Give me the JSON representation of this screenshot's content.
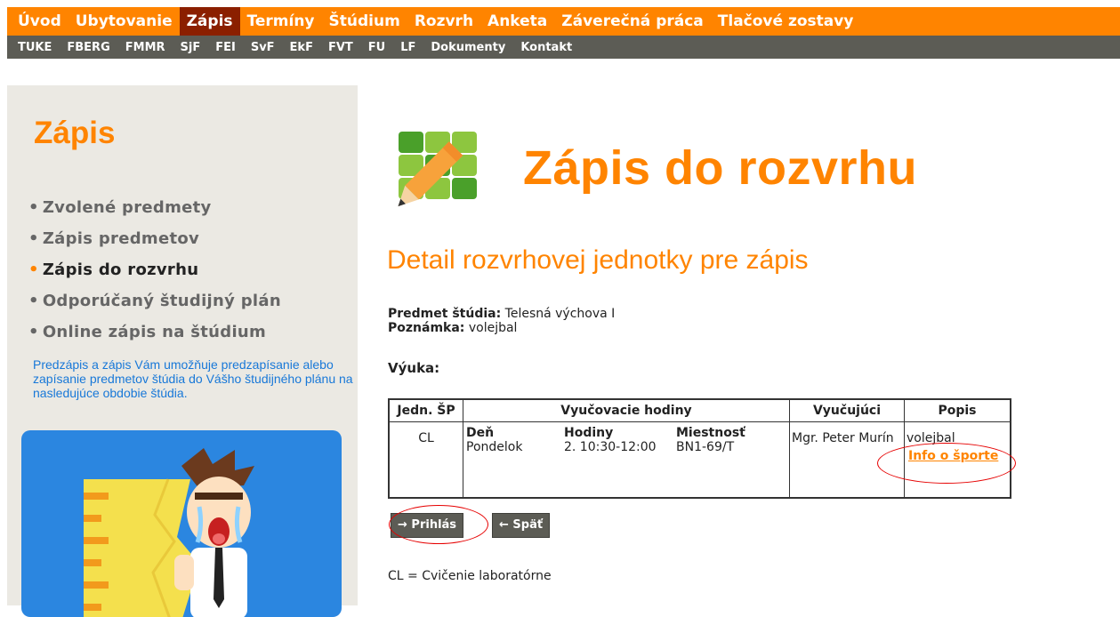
{
  "nav_primary": [
    {
      "label": "Úvod",
      "active": false
    },
    {
      "label": "Ubytovanie",
      "active": false
    },
    {
      "label": "Zápis",
      "active": true
    },
    {
      "label": "Termíny",
      "active": false
    },
    {
      "label": "Štúdium",
      "active": false
    },
    {
      "label": "Rozvrh",
      "active": false
    },
    {
      "label": "Anketa",
      "active": false
    },
    {
      "label": "Záverečná práca",
      "active": false
    },
    {
      "label": "Tlačové zostavy",
      "active": false
    }
  ],
  "nav_secondary": [
    "TUKE",
    "FBERG",
    "FMMR",
    "SjF",
    "FEI",
    "SvF",
    "EkF",
    "FVT",
    "FU",
    "LF",
    "Dokumenty",
    "Kontakt"
  ],
  "sidebar": {
    "title": "Zápis",
    "menu": [
      {
        "label": "Zvolené predmety",
        "active": false
      },
      {
        "label": "Zápis predmetov",
        "active": false
      },
      {
        "label": "Zápis do rozvrhu",
        "active": true
      },
      {
        "label": "Odporúčaný študijný plán",
        "active": false
      },
      {
        "label": "Online zápis na štúdium",
        "active": false
      }
    ],
    "description": "Predzápis a zápis Vám umožňuje predzapísanie alebo zapísanie predmetov štúdia do Vášho študijného plánu na nasledujúce obdobie štúdia."
  },
  "main": {
    "title": "Zápis do rozvrhu",
    "subtitle": "Detail rozvrhovej jednotky pre zápis",
    "subject_label": "Predmet štúdia:",
    "subject_value": "Telesná výchova I",
    "note_label": "Poznámka:",
    "note_value": "volejbal",
    "vyuka_label": "Výuka:",
    "table": {
      "headers": {
        "jedn": "Jedn. ŠP",
        "hodiny": "Vyučovacie hodiny",
        "vyucujuci": "Vyučujúci",
        "popis": "Popis"
      },
      "sub_headers": {
        "den": "Deň",
        "hodiny": "Hodiny",
        "miestnost": "Miestnosť"
      },
      "row": {
        "jedn": "CL",
        "den": "Pondelok",
        "hodiny": "2. 10:30-12:00",
        "miestnost": "BN1-69/T",
        "vyucujuci": "Mgr. Peter Murín",
        "popis": "volejbal",
        "link": "Info o športe"
      }
    },
    "buttons": {
      "prihlas": "→ Prihlás",
      "spat": "← Späť"
    },
    "legend": "CL = Cvičenie laboratórne"
  },
  "colors": {
    "accent": "#ff8400",
    "nav_active": "#8b1f00",
    "nav_secondary": "#5c5c55",
    "sidebar_bg": "#ebe9e3",
    "link_blue": "#1878d8",
    "highlight_ring": "#e60000"
  }
}
